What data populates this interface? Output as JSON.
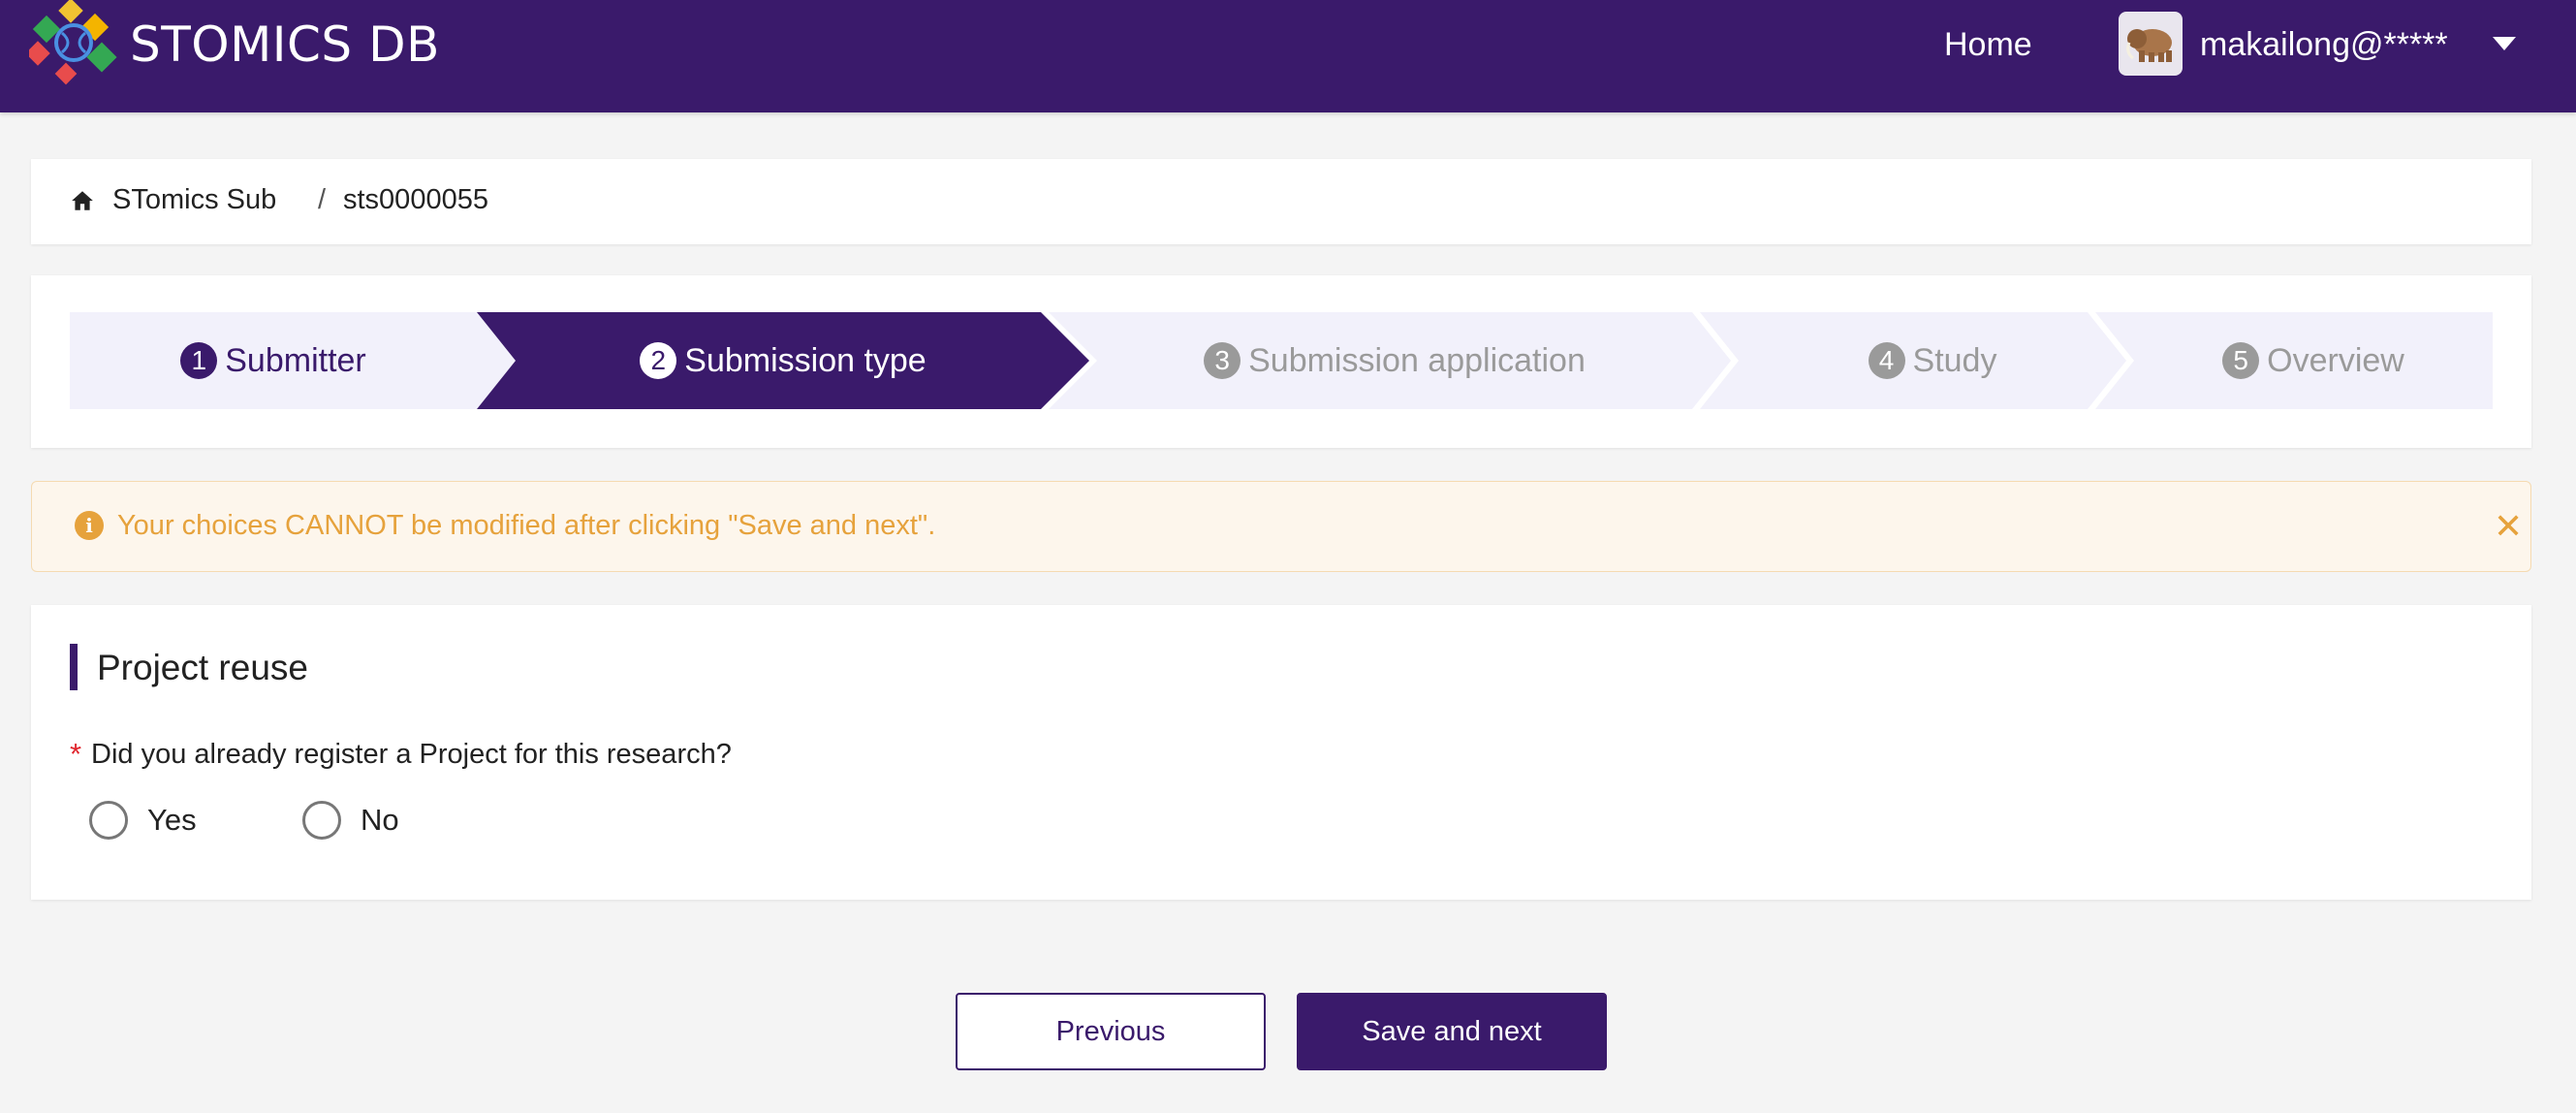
{
  "header": {
    "brand": "STOMICS DB",
    "nav_home": "Home",
    "user_name": "makailong@*****"
  },
  "breadcrumb": {
    "items": [
      "STomics Sub",
      "sts0000055"
    ],
    "separator": "/"
  },
  "steps": [
    {
      "num": "1",
      "label": "Submitter",
      "state": "done"
    },
    {
      "num": "2",
      "label": "Submission type",
      "state": "active"
    },
    {
      "num": "3",
      "label": "Submission application",
      "state": "todo"
    },
    {
      "num": "4",
      "label": "Study",
      "state": "todo"
    },
    {
      "num": "5",
      "label": "Overview",
      "state": "todo"
    }
  ],
  "alert": {
    "text": "Your choices CANNOT be modified after clicking \"Save and next\".",
    "close": "✕"
  },
  "section": {
    "title": "Project reuse",
    "required_mark": "*",
    "question": "Did you already register a Project for this research?",
    "options": [
      "Yes",
      "No"
    ]
  },
  "buttons": {
    "previous": "Previous",
    "save_next": "Save and next"
  },
  "colors": {
    "primary": "#3a1a6b",
    "step_inactive_bg": "#f2f1fb",
    "alert_bg": "#fdf6ec",
    "alert_text": "#e6a23c",
    "required": "#e0242c"
  }
}
